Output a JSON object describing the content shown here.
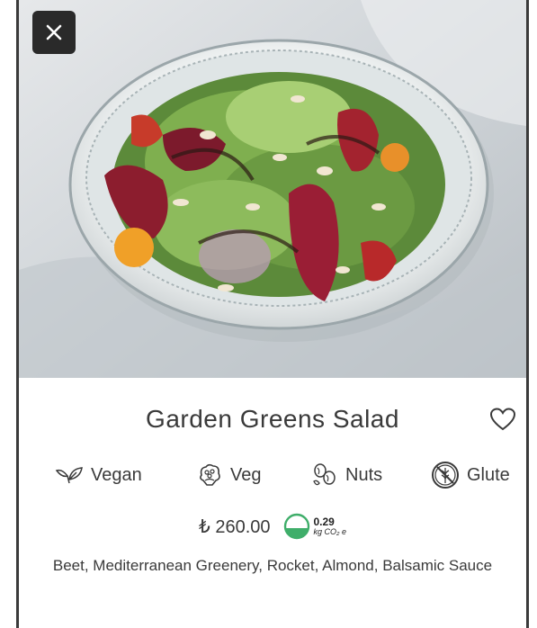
{
  "product": {
    "title": "Garden Greens Salad",
    "price": "₺ 260.00",
    "co2_value": "0.29",
    "co2_unit": "kg CO₂ e",
    "description": "Beet, Mediterranean Greenery, Rocket, Almond, Balsamic Sauce"
  },
  "tags": [
    {
      "label": "Vegan",
      "icon": "leaves-icon"
    },
    {
      "label": "Veg",
      "icon": "cauliflower-icon"
    },
    {
      "label": "Nuts",
      "icon": "nuts-icon"
    },
    {
      "label": "Glute",
      "icon": "gluten-free-icon"
    }
  ],
  "icons": {
    "close": "close-icon",
    "favorite": "heart-icon",
    "co2": "co2-gauge-icon"
  },
  "colors": {
    "close_bg": "#2a2a2a",
    "text": "#3a3a3a",
    "co2_green": "#3fae6a"
  }
}
